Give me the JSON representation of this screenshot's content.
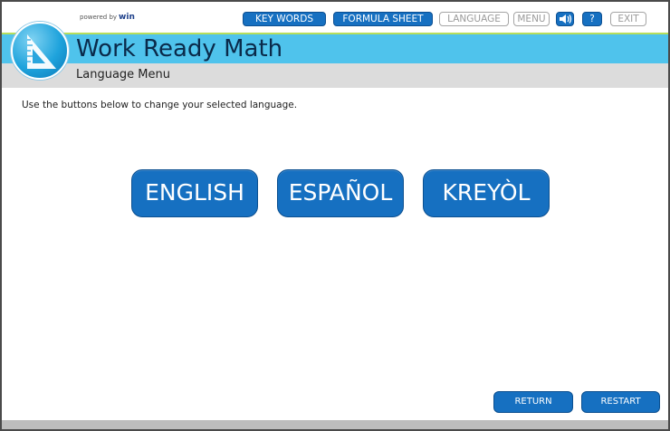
{
  "toolbar": {
    "powered_prefix": "powered by",
    "powered_brand": "win",
    "keywords_label": "KEY WORDS",
    "formula_label": "FORMULA SHEET",
    "language_label": "LANGUAGE",
    "menu_label": "MENU",
    "help_label": "?",
    "exit_label": "EXIT",
    "audio_icon": "speaker-icon"
  },
  "header": {
    "app_title": "Work Ready Math",
    "subtitle": "Language Menu",
    "logo_icon": "ruler-triangle-icon"
  },
  "main": {
    "instructions": "Use the buttons below to change your selected language.",
    "languages": [
      {
        "label": "ENGLISH"
      },
      {
        "label": "ESPAÑOL"
      },
      {
        "label": "KREYÒL"
      }
    ]
  },
  "footer": {
    "return_label": "RETURN",
    "restart_label": "RESTART"
  },
  "colors": {
    "accent_blue": "#1670c1",
    "title_band": "#4fc3ec",
    "accent_green": "#b7de5b",
    "subtitle_band": "#dcdcdc"
  }
}
